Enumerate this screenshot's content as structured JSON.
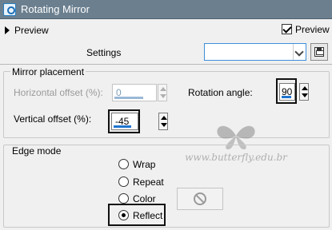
{
  "window": {
    "title": "Rotating Mirror"
  },
  "toolbar": {
    "preview_toggle": "Preview",
    "preview_checkbox": "Preview o",
    "preview_checked": true
  },
  "settings": {
    "label": "Settings",
    "value": ""
  },
  "mirror_placement": {
    "title": "Mirror placement",
    "horizontal_offset": {
      "label": "Horizontal offset (%):",
      "value": "0",
      "enabled": false
    },
    "vertical_offset": {
      "label": "Vertical offset (%):",
      "value": "-45",
      "enabled": true
    },
    "rotation_angle": {
      "label": "Rotation angle:",
      "value": "90",
      "enabled": true
    }
  },
  "edge_mode": {
    "title": "Edge mode",
    "options": [
      {
        "label": "Wrap",
        "checked": false
      },
      {
        "label": "Repeat",
        "checked": false
      },
      {
        "label": "Color",
        "checked": false
      },
      {
        "label": "Reflect",
        "checked": true
      }
    ]
  },
  "watermark": {
    "text": "www.butterfly.edu.br"
  },
  "colors": {
    "titlebar": "#6b7f8f",
    "accent": "#1e74d0",
    "highlight": "#111111"
  },
  "icons": [
    "app-icon",
    "chevron-down-icon",
    "save-icon",
    "no-entry-icon",
    "butterfly-icon"
  ]
}
